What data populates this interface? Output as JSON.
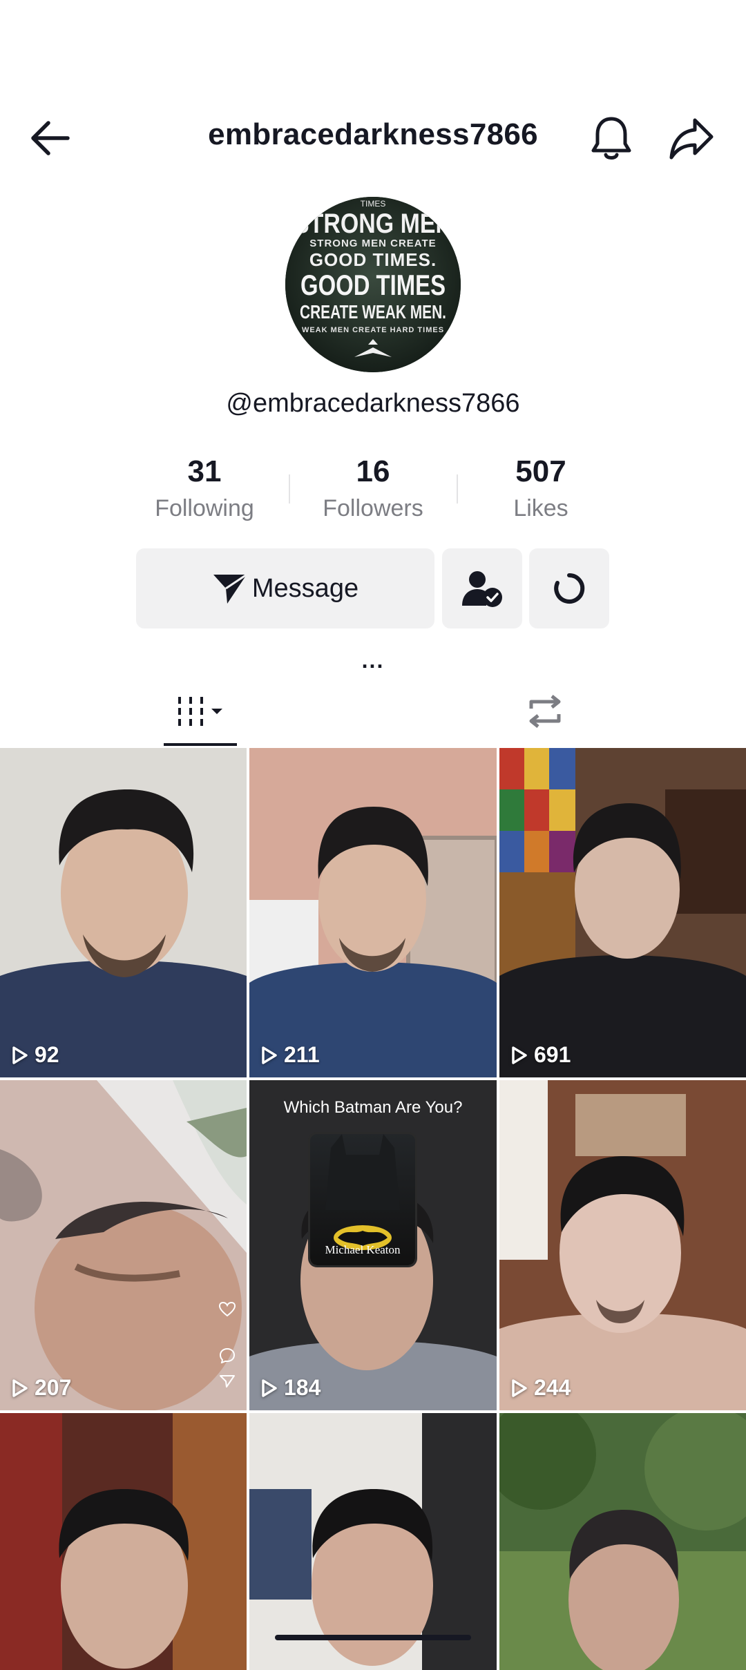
{
  "header": {
    "title": "embracedarkness7866"
  },
  "profile": {
    "avatar_lines": [
      "STRONG MEN",
      "STRONG MEN CREATE",
      "GOOD TIMES.",
      "GOOD TIMES",
      "CREATE WEAK MEN.",
      "WEAK MEN CREATE HARD TIMES"
    ],
    "handle": "@embracedarkness7866"
  },
  "stats": [
    {
      "value": "31",
      "label": "Following"
    },
    {
      "value": "16",
      "label": "Followers"
    },
    {
      "value": "507",
      "label": "Likes"
    }
  ],
  "actions": {
    "message_label": "Message"
  },
  "more_label": "...",
  "tabs": [
    {
      "icon": "videos-grid-icon",
      "active": true
    },
    {
      "icon": "repost-icon",
      "active": false
    }
  ],
  "videos": [
    {
      "views": "92"
    },
    {
      "views": "211"
    },
    {
      "views": "691"
    },
    {
      "views": "207"
    },
    {
      "views": "184",
      "overlay_text": "Which Batman Are You?",
      "card_label": "Michael Keaton"
    },
    {
      "views": "244"
    },
    {
      "views": ""
    },
    {
      "views": ""
    },
    {
      "views": ""
    }
  ]
}
